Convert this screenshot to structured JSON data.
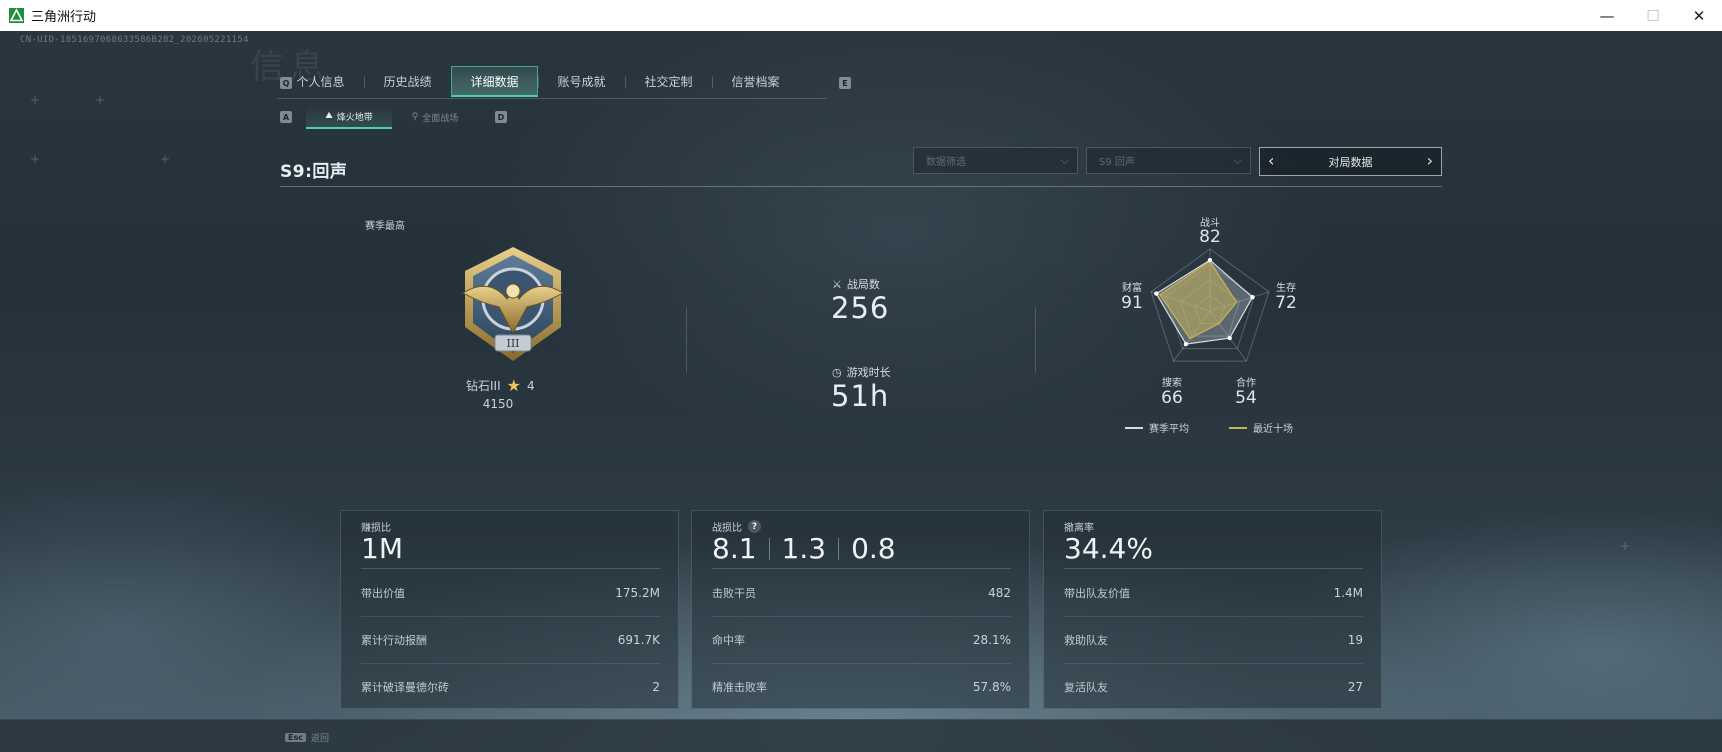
{
  "window": {
    "title": "三角洲行动",
    "buttons": {
      "minimize": "—",
      "maximize": "☐",
      "close": "✕"
    }
  },
  "uid": "CN-UID-1851697068633586B282_202605221154",
  "bg_ghost_text": "信息",
  "tabs": {
    "key_left": "Q",
    "key_right": "E",
    "items": [
      {
        "label": "个人信息",
        "active": false
      },
      {
        "label": "历史战绩",
        "active": false
      },
      {
        "label": "详细数据",
        "active": true
      },
      {
        "label": "账号成就",
        "active": false
      },
      {
        "label": "社交定制",
        "active": false
      },
      {
        "label": "信誉档案",
        "active": false
      }
    ]
  },
  "subtabs": {
    "key_left": "A",
    "key_right": "D",
    "items": [
      {
        "label": "烽火地带",
        "icon": "landscape-icon",
        "active": true
      },
      {
        "label": "全面战场",
        "icon": "antenna-icon",
        "active": false
      }
    ]
  },
  "season": {
    "title": "S9:回声"
  },
  "filters": {
    "dropdown1": "数据筛选",
    "dropdown2": "S9 回声",
    "pager_label": "对局数据"
  },
  "rank": {
    "caption": "赛季最高",
    "name": "钻石III",
    "stars": "4",
    "points": "4150"
  },
  "center_stats": {
    "matches_label": "战局数",
    "matches_value": "256",
    "playtime_label": "游戏时长",
    "playtime_value": "51h"
  },
  "radar": {
    "axes": [
      {
        "label": "战斗",
        "value": "82"
      },
      {
        "label": "生存",
        "value": "72"
      },
      {
        "label": "合作",
        "value": "54"
      },
      {
        "label": "搜索",
        "value": "66"
      },
      {
        "label": "财富",
        "value": "91"
      }
    ],
    "recent_values": [
      0.8,
      0.45,
      0.25,
      0.55,
      0.85
    ],
    "legend": {
      "season_avg": "赛季平均",
      "recent_ten": "最近十场"
    },
    "colors": {
      "season_avg": "#d6dde2",
      "recent_ten": "#c8b25a"
    }
  },
  "cards": {
    "profit": {
      "title": "赚损比",
      "big": "1M",
      "rows": [
        {
          "label": "带出价值",
          "value": "175.2M"
        },
        {
          "label": "累计行动报酬",
          "value": "691.7K"
        },
        {
          "label": "累计破译曼德尔砖",
          "value": "2"
        }
      ]
    },
    "kd": {
      "title": "战损比",
      "help": "?",
      "big": [
        "8.1",
        "1.3",
        "0.8"
      ],
      "rows": [
        {
          "label": "击败干员",
          "value": "482"
        },
        {
          "label": "命中率",
          "value": "28.1%"
        },
        {
          "label": "精准击败率",
          "value": "57.8%"
        }
      ]
    },
    "extract": {
      "title": "撤离率",
      "big": "34.4%",
      "rows": [
        {
          "label": "带出队友价值",
          "value": "1.4M"
        },
        {
          "label": "救助队友",
          "value": "19"
        },
        {
          "label": "复活队友",
          "value": "27"
        }
      ]
    }
  },
  "footer": {
    "esc_key": "Esc",
    "esc_label": "返回"
  }
}
